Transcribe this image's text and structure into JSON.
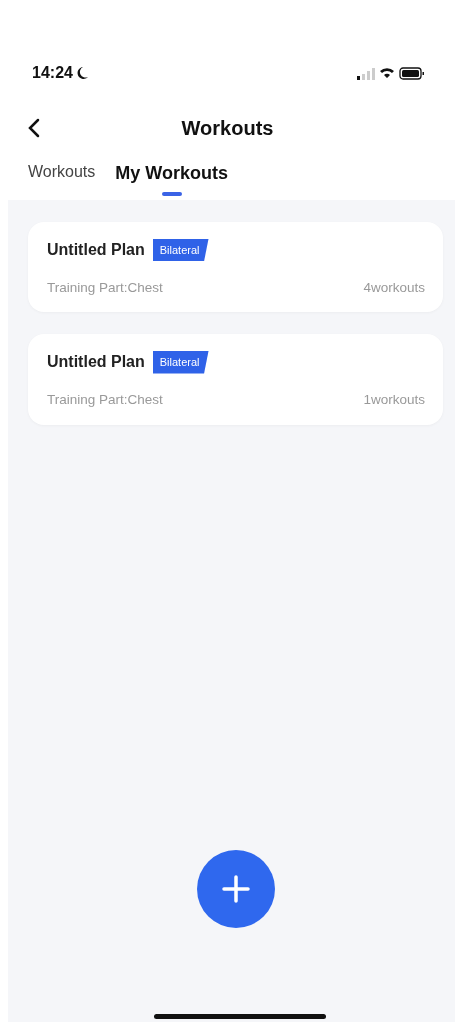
{
  "status_bar": {
    "time": "14:24"
  },
  "header": {
    "title": "Workouts"
  },
  "tabs": [
    {
      "label": "Workouts",
      "selected": false
    },
    {
      "label": "My Workouts",
      "selected": true
    }
  ],
  "plans": [
    {
      "title": "Untitled Plan",
      "tag": "Bilateral",
      "training_part": "Training Part:Chest",
      "count": "4workouts"
    },
    {
      "title": "Untitled Plan",
      "tag": "Bilateral",
      "training_part": "Training Part:Chest",
      "count": "1workouts"
    }
  ]
}
